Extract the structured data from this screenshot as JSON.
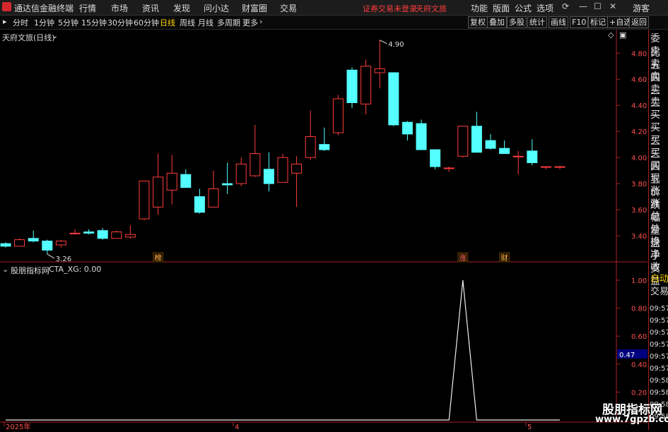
{
  "titlebar": {
    "app_name": "通达信金融终端",
    "menus": [
      "行情",
      "市场",
      "资讯",
      "发现",
      "问小达",
      "财富圈",
      "交易"
    ],
    "notice": "证券交易未登录",
    "stock_name": "天府文旅",
    "right_menus": [
      "功能",
      "版面",
      "公式",
      "选项"
    ],
    "guest": "游客"
  },
  "toolbar": {
    "periods": [
      "分时",
      "1分钟",
      "5分钟",
      "15分钟",
      "30分钟",
      "60分钟",
      "日线",
      "周线",
      "月线",
      "多周期",
      "更多"
    ],
    "active_period": "日线",
    "buttons": [
      "复权",
      "叠加",
      "多股",
      "统计",
      "画线",
      "F10",
      "标记",
      "+自选",
      "返回"
    ]
  },
  "main_chart": {
    "title": "天府文旅(日线)",
    "y_ticks": [
      "4.80",
      "4.60",
      "4.40",
      "4.20",
      "4.00",
      "3.80",
      "3.60",
      "3.40"
    ],
    "high_label": "4.90",
    "low_label": "3.26",
    "markers": [
      "榜",
      "涨",
      "财"
    ]
  },
  "indicator": {
    "title": "股朋指标网",
    "formula": "CTA_XG: 0.00",
    "y_ticks": [
      "1.00",
      "0.80",
      "0.60",
      "0.40",
      "0.20"
    ],
    "current_value": "0.47"
  },
  "x_axis": {
    "labels": [
      "2025年",
      "4",
      "5"
    ]
  },
  "right_panel": {
    "items": [
      "委比",
      "卖五",
      "卖四",
      "卖三",
      "卖二",
      "卖一",
      "买一",
      "买二",
      "买三",
      "买四",
      "买五",
      "现价",
      "涨跌",
      "涨幅",
      "总量",
      "外盘",
      "换手",
      "净资",
      "收益"
    ],
    "auto_label": "自动",
    "trade_label": "交易",
    "times": [
      "09:57",
      "09:57",
      "09:57",
      "09:57",
      "09:57",
      "09:57",
      "09:58",
      "09:58",
      "09:58",
      "09:58"
    ]
  },
  "colors": {
    "up": "#ff3c3c",
    "down": "#54ffff",
    "accent": "#ffd400"
  },
  "chart_data": {
    "type": "candlestick",
    "ylim": [
      3.2,
      4.98
    ],
    "candles": [
      {
        "o": 3.34,
        "h": 3.35,
        "l": 3.31,
        "c": 3.32
      },
      {
        "o": 3.32,
        "h": 3.38,
        "l": 3.32,
        "c": 3.37
      },
      {
        "o": 3.38,
        "h": 3.44,
        "l": 3.35,
        "c": 3.36
      },
      {
        "o": 3.36,
        "h": 3.37,
        "l": 3.26,
        "c": 3.29
      },
      {
        "o": 3.33,
        "h": 3.37,
        "l": 3.31,
        "c": 3.36
      },
      {
        "o": 3.42,
        "h": 3.45,
        "l": 3.41,
        "c": 3.42
      },
      {
        "o": 3.43,
        "h": 3.45,
        "l": 3.41,
        "c": 3.42
      },
      {
        "o": 3.44,
        "h": 3.46,
        "l": 3.37,
        "c": 3.38
      },
      {
        "o": 3.38,
        "h": 3.44,
        "l": 3.38,
        "c": 3.43
      },
      {
        "o": 3.39,
        "h": 3.48,
        "l": 3.38,
        "c": 3.41
      },
      {
        "o": 3.53,
        "h": 3.82,
        "l": 3.52,
        "c": 3.82
      },
      {
        "o": 3.62,
        "h": 4.03,
        "l": 3.56,
        "c": 3.85
      },
      {
        "o": 3.75,
        "h": 4.02,
        "l": 3.64,
        "c": 3.88
      },
      {
        "o": 3.87,
        "h": 3.91,
        "l": 3.78,
        "c": 3.77
      },
      {
        "o": 3.7,
        "h": 3.76,
        "l": 3.57,
        "c": 3.58
      },
      {
        "o": 3.62,
        "h": 3.9,
        "l": 3.62,
        "c": 3.76
      },
      {
        "o": 3.8,
        "h": 3.96,
        "l": 3.72,
        "c": 3.79
      },
      {
        "o": 3.8,
        "h": 4.0,
        "l": 3.78,
        "c": 3.95
      },
      {
        "o": 3.86,
        "h": 4.25,
        "l": 3.85,
        "c": 4.03
      },
      {
        "o": 3.91,
        "h": 4.04,
        "l": 3.74,
        "c": 3.8
      },
      {
        "o": 3.81,
        "h": 4.03,
        "l": 3.81,
        "c": 4.0
      },
      {
        "o": 3.88,
        "h": 4.01,
        "l": 3.62,
        "c": 3.95
      },
      {
        "o": 4.0,
        "h": 4.36,
        "l": 3.98,
        "c": 4.16
      },
      {
        "o": 4.1,
        "h": 4.23,
        "l": 4.05,
        "c": 4.06
      },
      {
        "o": 4.19,
        "h": 4.48,
        "l": 4.17,
        "c": 4.45
      },
      {
        "o": 4.67,
        "h": 4.69,
        "l": 4.38,
        "c": 4.42
      },
      {
        "o": 4.41,
        "h": 4.75,
        "l": 4.33,
        "c": 4.7
      },
      {
        "o": 4.65,
        "h": 4.9,
        "l": 4.53,
        "c": 4.68
      },
      {
        "o": 4.65,
        "h": 4.65,
        "l": 4.24,
        "c": 4.25
      },
      {
        "o": 4.27,
        "h": 4.28,
        "l": 4.13,
        "c": 4.18
      },
      {
        "o": 4.26,
        "h": 4.29,
        "l": 4.06,
        "c": 4.06
      },
      {
        "o": 4.06,
        "h": 4.06,
        "l": 3.91,
        "c": 3.93
      },
      {
        "o": 3.92,
        "h": 3.93,
        "l": 3.89,
        "c": 3.92
      },
      {
        "o": 4.01,
        "h": 4.24,
        "l": 4.0,
        "c": 4.24
      },
      {
        "o": 4.24,
        "h": 4.35,
        "l": 4.06,
        "c": 4.04
      },
      {
        "o": 4.13,
        "h": 4.18,
        "l": 4.06,
        "c": 4.07
      },
      {
        "o": 4.07,
        "h": 4.13,
        "l": 4.04,
        "c": 4.03
      },
      {
        "o": 4.01,
        "h": 4.05,
        "l": 3.87,
        "c": 4.01
      },
      {
        "o": 4.05,
        "h": 4.14,
        "l": 3.94,
        "c": 3.96
      },
      {
        "o": 3.93,
        "h": 3.93,
        "l": 3.91,
        "c": 3.93
      },
      {
        "o": 3.93,
        "h": 3.93,
        "l": 3.91,
        "c": 3.93
      }
    ],
    "indicator_series": {
      "name": "CTA_XG",
      "ylim": [
        0,
        1.05
      ],
      "values": [
        0,
        0,
        0,
        0,
        0,
        0,
        0,
        0,
        0,
        0,
        0,
        0,
        0,
        0,
        0,
        0,
        0,
        0,
        0,
        0,
        0,
        0,
        0,
        0,
        0,
        0,
        0,
        0,
        0,
        0,
        0,
        0,
        0,
        1,
        0,
        0,
        0,
        0,
        0,
        0,
        0
      ]
    }
  }
}
